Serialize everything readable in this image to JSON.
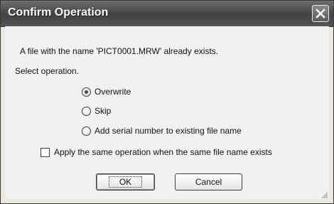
{
  "dialog": {
    "title": "Confirm Operation",
    "message": "A file with the name 'PICT0001.MRW' already exists.",
    "prompt": "Select operation.",
    "options": [
      {
        "label": "Overwrite",
        "selected": true
      },
      {
        "label": "Skip",
        "selected": false
      },
      {
        "label": "Add serial number to existing file name",
        "selected": false
      }
    ],
    "apply_same": {
      "label": "Apply the same operation when the same file name exists",
      "checked": false
    },
    "ok_label": "OK",
    "cancel_label": "Cancel"
  },
  "icons": {
    "close": "close-icon"
  },
  "colors": {
    "titlebar": "#4a4a4a",
    "client": "#f1f1f1",
    "frame": "#ece9d8"
  }
}
